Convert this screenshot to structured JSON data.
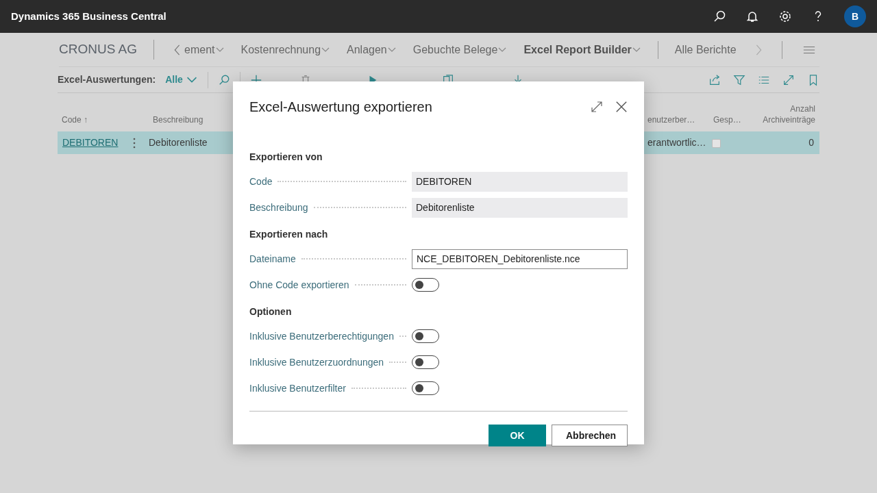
{
  "app_bar": {
    "title": "Dynamics 365 Business Central",
    "avatar": "B"
  },
  "nav": {
    "company": "CRONUS AG",
    "items": [
      {
        "label": "ement",
        "bold": false
      },
      {
        "label": "Kostenrechnung",
        "bold": false
      },
      {
        "label": "Anlagen",
        "bold": false
      },
      {
        "label": "Gebuchte Belege",
        "bold": false
      },
      {
        "label": "Excel Report Builder",
        "bold": true
      }
    ],
    "more": "Alle Berichte"
  },
  "action_bar": {
    "label": "Excel-Auswertungen:",
    "filter": "Alle",
    "actions": [
      {
        "kind": "plus"
      },
      {
        "kind": "trash"
      },
      {
        "kind": "play"
      },
      {
        "kind": "copy"
      },
      {
        "kind": "download"
      }
    ]
  },
  "table": {
    "columns": [
      "Code ↑",
      "Beschreibung",
      "enutzerber…",
      "Gesp…",
      "Anzahl Archiveinträge"
    ],
    "rows": [
      {
        "code": "DEBITOREN",
        "description": "Debitorenliste",
        "column_3": "erantwortlic…",
        "locked": false,
        "count": "0",
        "selected": true
      }
    ]
  },
  "dialog": {
    "title": "Excel-Auswertung exportieren",
    "sections": [
      {
        "heading": "Exportieren von",
        "fields": [
          {
            "label": "Code",
            "kind": "readonly",
            "value": "DEBITOREN"
          },
          {
            "label": "Beschreibung",
            "kind": "readonly",
            "value": "Debitorenliste"
          }
        ]
      },
      {
        "heading": "Exportieren nach",
        "fields": [
          {
            "label": "Dateiname",
            "kind": "input",
            "value": "NCE_DEBITOREN_Debitorenliste.nce"
          },
          {
            "label": "Ohne Code exportieren",
            "kind": "toggle",
            "on": false
          }
        ]
      },
      {
        "heading": "Optionen",
        "fields": [
          {
            "label": "Inklusive Benutzerberechtigungen",
            "kind": "toggle",
            "on": false
          },
          {
            "label": "Inklusive Benutzerzuordnungen",
            "kind": "toggle",
            "on": false
          },
          {
            "label": "Inklusive Benutzerfilter",
            "kind": "toggle",
            "on": false
          }
        ]
      }
    ],
    "buttons": [
      {
        "label": "OK",
        "primary": true
      },
      {
        "label": "Abbrechen",
        "primary": false
      }
    ]
  }
}
